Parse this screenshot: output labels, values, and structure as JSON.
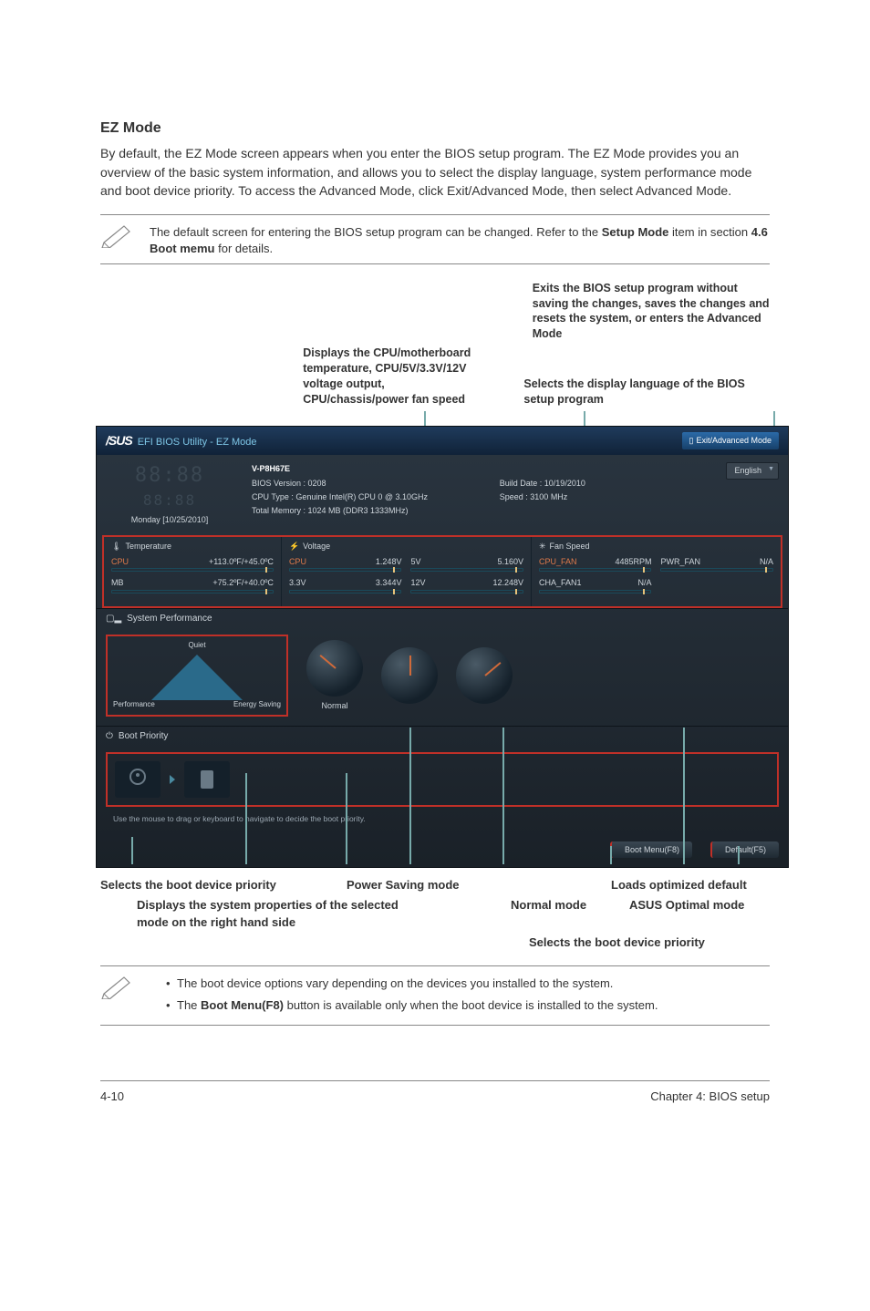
{
  "page": {
    "heading": "EZ Mode",
    "intro": "By default, the EZ Mode screen appears when you enter the BIOS setup program. The EZ Mode provides you an overview of the basic system information, and allows you to select the display language, system performance mode and boot device priority. To access the Advanced Mode, click Exit/Advanced Mode, then select Advanced Mode.",
    "note1_pre": "The default screen for entering the BIOS setup program can be changed. Refer to the ",
    "note1_bold": "Setup Mode",
    "note1_mid": " item in s",
    "note1_sec": "ection ",
    "note1_bold2": "4.6 Boot memu",
    "note1_end": " for details.",
    "footer_left": "4-10",
    "footer_right": "Chapter 4: BIOS setup"
  },
  "callouts": {
    "top_left": "Displays the CPU/motherboard temperature, CPU/5V/3.3V/12V voltage output, CPU/chassis/power fan speed",
    "top_right1": "Exits the BIOS setup program without saving the changes, saves the changes and resets the system, or enters the Advanced Mode",
    "top_right2": "Selects the display language of the BIOS setup program",
    "bottom_1": "Selects the boot device  priority",
    "bottom_2": "Power Saving mode",
    "bottom_3": "Loads optimized default",
    "bottom_4": "Displays the system properties of the selected mode on the right hand side",
    "bottom_5": "Normal mode",
    "bottom_6": "ASUS Optimal mode",
    "bottom_7": "Selects the boot device priority"
  },
  "bios": {
    "asus": "/SUS",
    "title": "EFI BIOS Utility - EZ Mode",
    "exit_btn": "Exit/Advanced Mode",
    "clock_date": "Monday [10/25/2010]",
    "model": "V-P8H67E",
    "bios_ver": "BIOS Version : 0208",
    "cpu_type": "CPU Type : Genuine Intel(R) CPU 0 @ 3.10GHz",
    "total_mem": "Total Memory : 1024 MB (DDR3 1333MHz)",
    "build_date": "Build Date : 10/19/2010",
    "speed": "Speed : 3100 MHz",
    "lang": "English",
    "temp_hdr": "Temperature",
    "volt_hdr": "Voltage",
    "fan_hdr": "Fan Speed",
    "temp_cpu_lbl": "CPU",
    "temp_cpu_val": "+113.0ºF/+45.0ºC",
    "temp_mb_lbl": "MB",
    "temp_mb_val": "+75.2ºF/+40.0ºC",
    "v_cpu_lbl": "CPU",
    "v_cpu_val": "1.248V",
    "v_5v_lbl": "5V",
    "v_5v_val": "5.160V",
    "v_3v_lbl": "3.3V",
    "v_3v_val": "3.344V",
    "v_12v_lbl": "12V",
    "v_12v_val": "12.248V",
    "f_cpu_lbl": "CPU_FAN",
    "f_cpu_val": "4485RPM",
    "f_pwr_lbl": "PWR_FAN",
    "f_pwr_val": "N/A",
    "f_cha_lbl": "CHA_FAN1",
    "f_cha_val": "N/A",
    "sysperf_hdr": "System Performance",
    "quiet": "Quiet",
    "performance": "Performance",
    "energy": "Energy Saving",
    "normal": "Normal",
    "boot_hdr": "Boot Priority",
    "boot_hint": "Use the mouse to drag or keyboard to navigate to decide the boot priority.",
    "btn_bootmenu": "Boot Menu(F8)",
    "btn_default": "Default(F5)"
  },
  "notes_bottom": {
    "item1": "The boot device options vary depending on the devices you installed to the system.",
    "item2_pre": "The ",
    "item2_bold": "Boot Menu(F8)",
    "item2_end": " button is available only when the boot device is installed to the system."
  }
}
